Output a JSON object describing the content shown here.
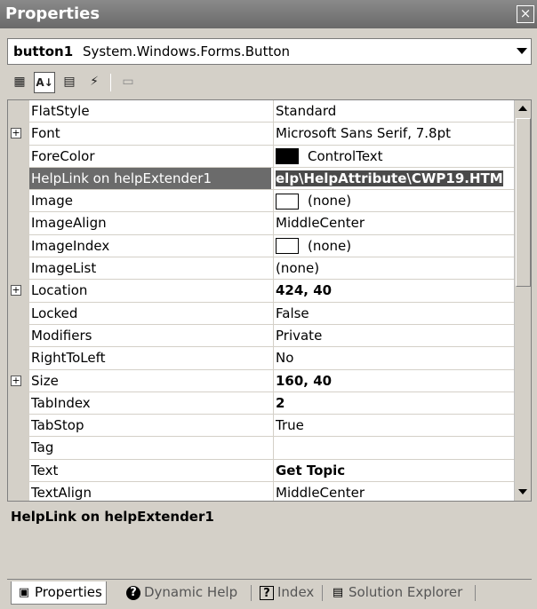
{
  "window": {
    "title": "Properties",
    "close_label": "×"
  },
  "object_selector": {
    "name": "button1",
    "type": "System.Windows.Forms.Button"
  },
  "toolbar": {
    "buttons": [
      {
        "icon": "categorized-icon",
        "glyph": "▦"
      },
      {
        "icon": "alphabetical-icon",
        "glyph": "A↓"
      },
      {
        "icon": "properties-icon",
        "glyph": "▤"
      },
      {
        "icon": "events-icon",
        "glyph": "⚡"
      },
      {
        "icon": "property-pages-icon",
        "glyph": "▭"
      }
    ]
  },
  "properties": [
    {
      "name": "FlatStyle",
      "value": "Standard"
    },
    {
      "name": "Font",
      "value": "Microsoft Sans Serif, 7.8pt",
      "expandable": true
    },
    {
      "name": "ForeColor",
      "value": "ControlText",
      "swatch": "black"
    },
    {
      "name": "HelpLink on helpExtender1",
      "value": "elp\\HelpAttribute\\CWP19.HTM",
      "selected": true
    },
    {
      "name": "Image",
      "value": "(none)",
      "swatch": "white"
    },
    {
      "name": "ImageAlign",
      "value": "MiddleCenter"
    },
    {
      "name": "ImageIndex",
      "value": "(none)",
      "swatch": "white"
    },
    {
      "name": "ImageList",
      "value": "(none)"
    },
    {
      "name": "Location",
      "value": "424, 40",
      "expandable": true,
      "bold": true
    },
    {
      "name": "Locked",
      "value": "False"
    },
    {
      "name": "Modifiers",
      "value": "Private"
    },
    {
      "name": "RightToLeft",
      "value": "No"
    },
    {
      "name": "Size",
      "value": "160, 40",
      "expandable": true,
      "bold": true
    },
    {
      "name": "TabIndex",
      "value": "2",
      "bold": true
    },
    {
      "name": "TabStop",
      "value": "True"
    },
    {
      "name": "Tag",
      "value": ""
    },
    {
      "name": "Text",
      "value": "Get Topic",
      "bold": true
    },
    {
      "name": "TextAlign",
      "value": "MiddleCenter"
    }
  ],
  "description": {
    "title": "HelpLink on helpExtender1"
  },
  "tabs": [
    {
      "label": "Properties",
      "icon": "properties-tab-icon",
      "glyph": "▣",
      "active": true
    },
    {
      "label": "Dynamic Help",
      "icon": "help-icon",
      "glyph": "?"
    },
    {
      "label": "Index",
      "icon": "index-icon",
      "glyph": "?"
    },
    {
      "label": "Solution Explorer",
      "icon": "solution-explorer-icon",
      "glyph": "▤"
    }
  ],
  "colors": {
    "titlebar": "#7a7a7a",
    "selected_name_bg": "#6b6b6b",
    "selected_value_bg": "#4a4a4a"
  }
}
